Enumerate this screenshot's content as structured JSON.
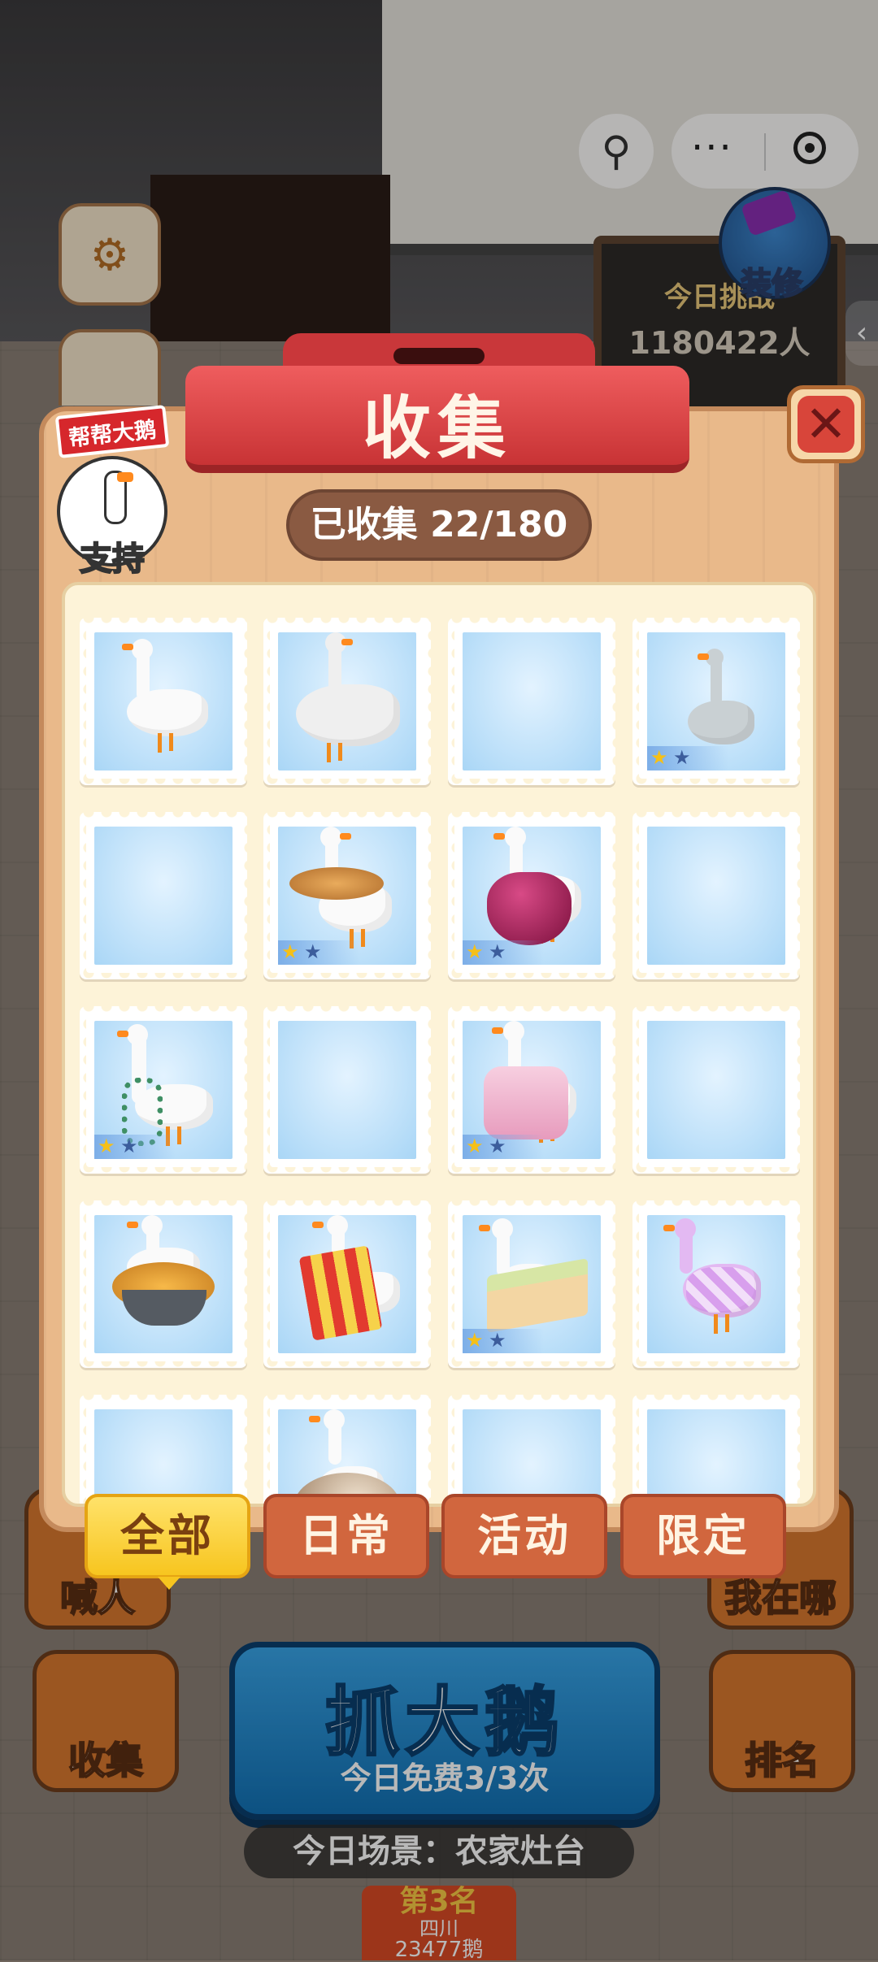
{
  "background": {
    "board_line1": "今日挑战",
    "board_line2": "1180422人",
    "decorate_label": "装修",
    "side_arrow": "‹",
    "left_icon": "⚙",
    "bottom_left_partial": "喊人",
    "bottom_right_partial": "我在哪",
    "collect_label": "收集",
    "rank_label": "排名",
    "grab_button": "抓大鹅",
    "grab_sub": "今日免费3/3次",
    "scene_text": "今日场景：农家灶台",
    "rank_place": "第3名",
    "rank_region": "四川",
    "rank_count": "23477鹅"
  },
  "capsule": {
    "more": "···"
  },
  "panel": {
    "title": "收集",
    "close_symbol": "✕",
    "support_flag": "帮帮大鹅",
    "support_label": "支持",
    "collected_text": "已收集 22/180"
  },
  "stamps": [
    {
      "filled": true,
      "variant": "plain",
      "stars": false
    },
    {
      "filled": true,
      "variant": "bun",
      "stars": false
    },
    {
      "filled": false,
      "variant": "empty",
      "stars": false
    },
    {
      "filled": true,
      "variant": "grey",
      "stars": true
    },
    {
      "filled": false,
      "variant": "empty",
      "stars": false
    },
    {
      "filled": true,
      "variant": "flatbread",
      "stars": true
    },
    {
      "filled": true,
      "variant": "onion",
      "stars": true
    },
    {
      "filled": false,
      "variant": "empty",
      "stars": false
    },
    {
      "filled": true,
      "variant": "necklace",
      "stars": true
    },
    {
      "filled": false,
      "variant": "empty",
      "stars": false
    },
    {
      "filled": true,
      "variant": "pink",
      "stars": true
    },
    {
      "filled": false,
      "variant": "empty",
      "stars": false
    },
    {
      "filled": true,
      "variant": "tart",
      "stars": false
    },
    {
      "filled": true,
      "variant": "fries",
      "stars": false
    },
    {
      "filled": true,
      "variant": "cake",
      "stars": true
    },
    {
      "filled": true,
      "variant": "crystal",
      "stars": false
    },
    {
      "filled": false,
      "variant": "empty",
      "stars": false
    },
    {
      "filled": true,
      "variant": "mushroom",
      "stars": false
    },
    {
      "filled": false,
      "variant": "empty",
      "stars": false
    },
    {
      "filled": false,
      "variant": "empty",
      "stars": false
    }
  ],
  "star_glyph": "★",
  "tabs": [
    {
      "label": "全部",
      "active": true
    },
    {
      "label": "日常",
      "active": false
    },
    {
      "label": "活动",
      "active": false
    },
    {
      "label": "限定",
      "active": false
    }
  ]
}
